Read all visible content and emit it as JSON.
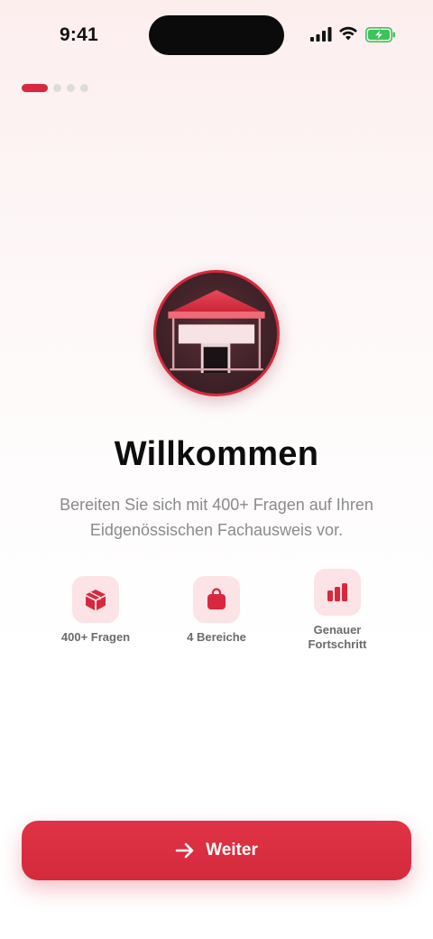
{
  "status_bar": {
    "time": "9:41"
  },
  "pager": {
    "total": 4,
    "active": 0
  },
  "welcome": {
    "title": "Willkommen",
    "subtitle": "Bereiten Sie sich mit 400+ Fragen auf Ihren Eidgenössischen Fachausweis vor."
  },
  "features": [
    {
      "icon": "box-icon",
      "label": "400+ Fragen"
    },
    {
      "icon": "bag-icon",
      "label": "4 Bereiche"
    },
    {
      "icon": "chart-bars-icon",
      "label": "Genauer Fortschritt"
    }
  ],
  "cta": {
    "label": "Weiter",
    "icon": "arrow-right-icon"
  },
  "colors": {
    "accent": "#d8283d",
    "icon_bg": "#fbe3e6",
    "subtitle": "#8a8a8a"
  }
}
